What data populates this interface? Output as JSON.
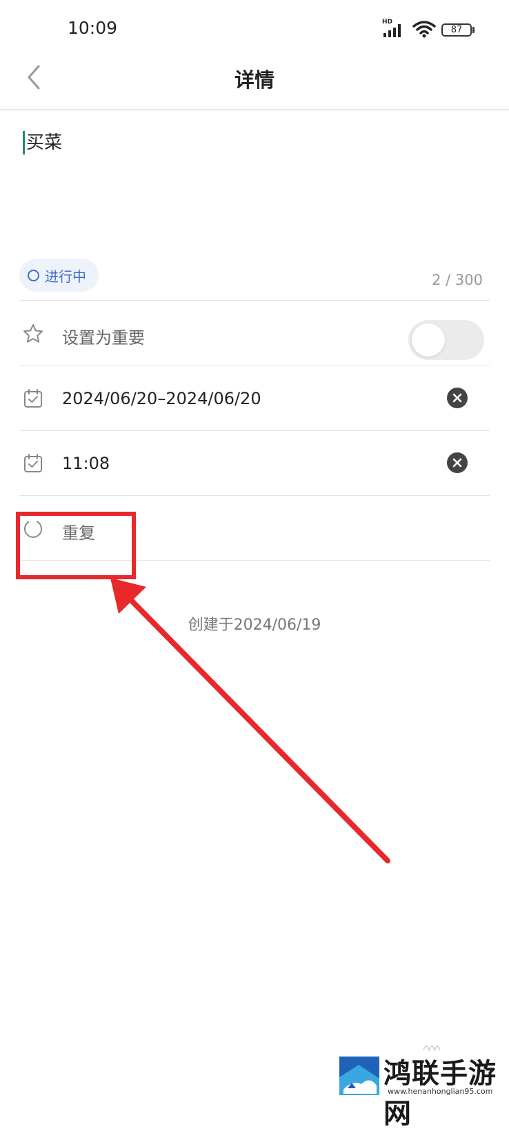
{
  "status_bar": {
    "time": "10:09",
    "network_label": "HD",
    "battery": "87"
  },
  "header": {
    "title": "详情"
  },
  "note": {
    "text": "买菜",
    "status": "进行中",
    "char_count": "2 / 300"
  },
  "rows": {
    "important_label": "设置为重要",
    "important_on": false,
    "date_range": "2024/06/20–2024/06/20",
    "time": "11:08",
    "repeat_label": "重复"
  },
  "footer": {
    "created": "创建于2024/06/19"
  },
  "colors": {
    "accent": "#3f6dcf",
    "cursor": "#1f8a70",
    "annotation": "#e8282b"
  },
  "watermark": {
    "title": "鸿联手游网",
    "url": "www.henanhonglian95.com"
  }
}
